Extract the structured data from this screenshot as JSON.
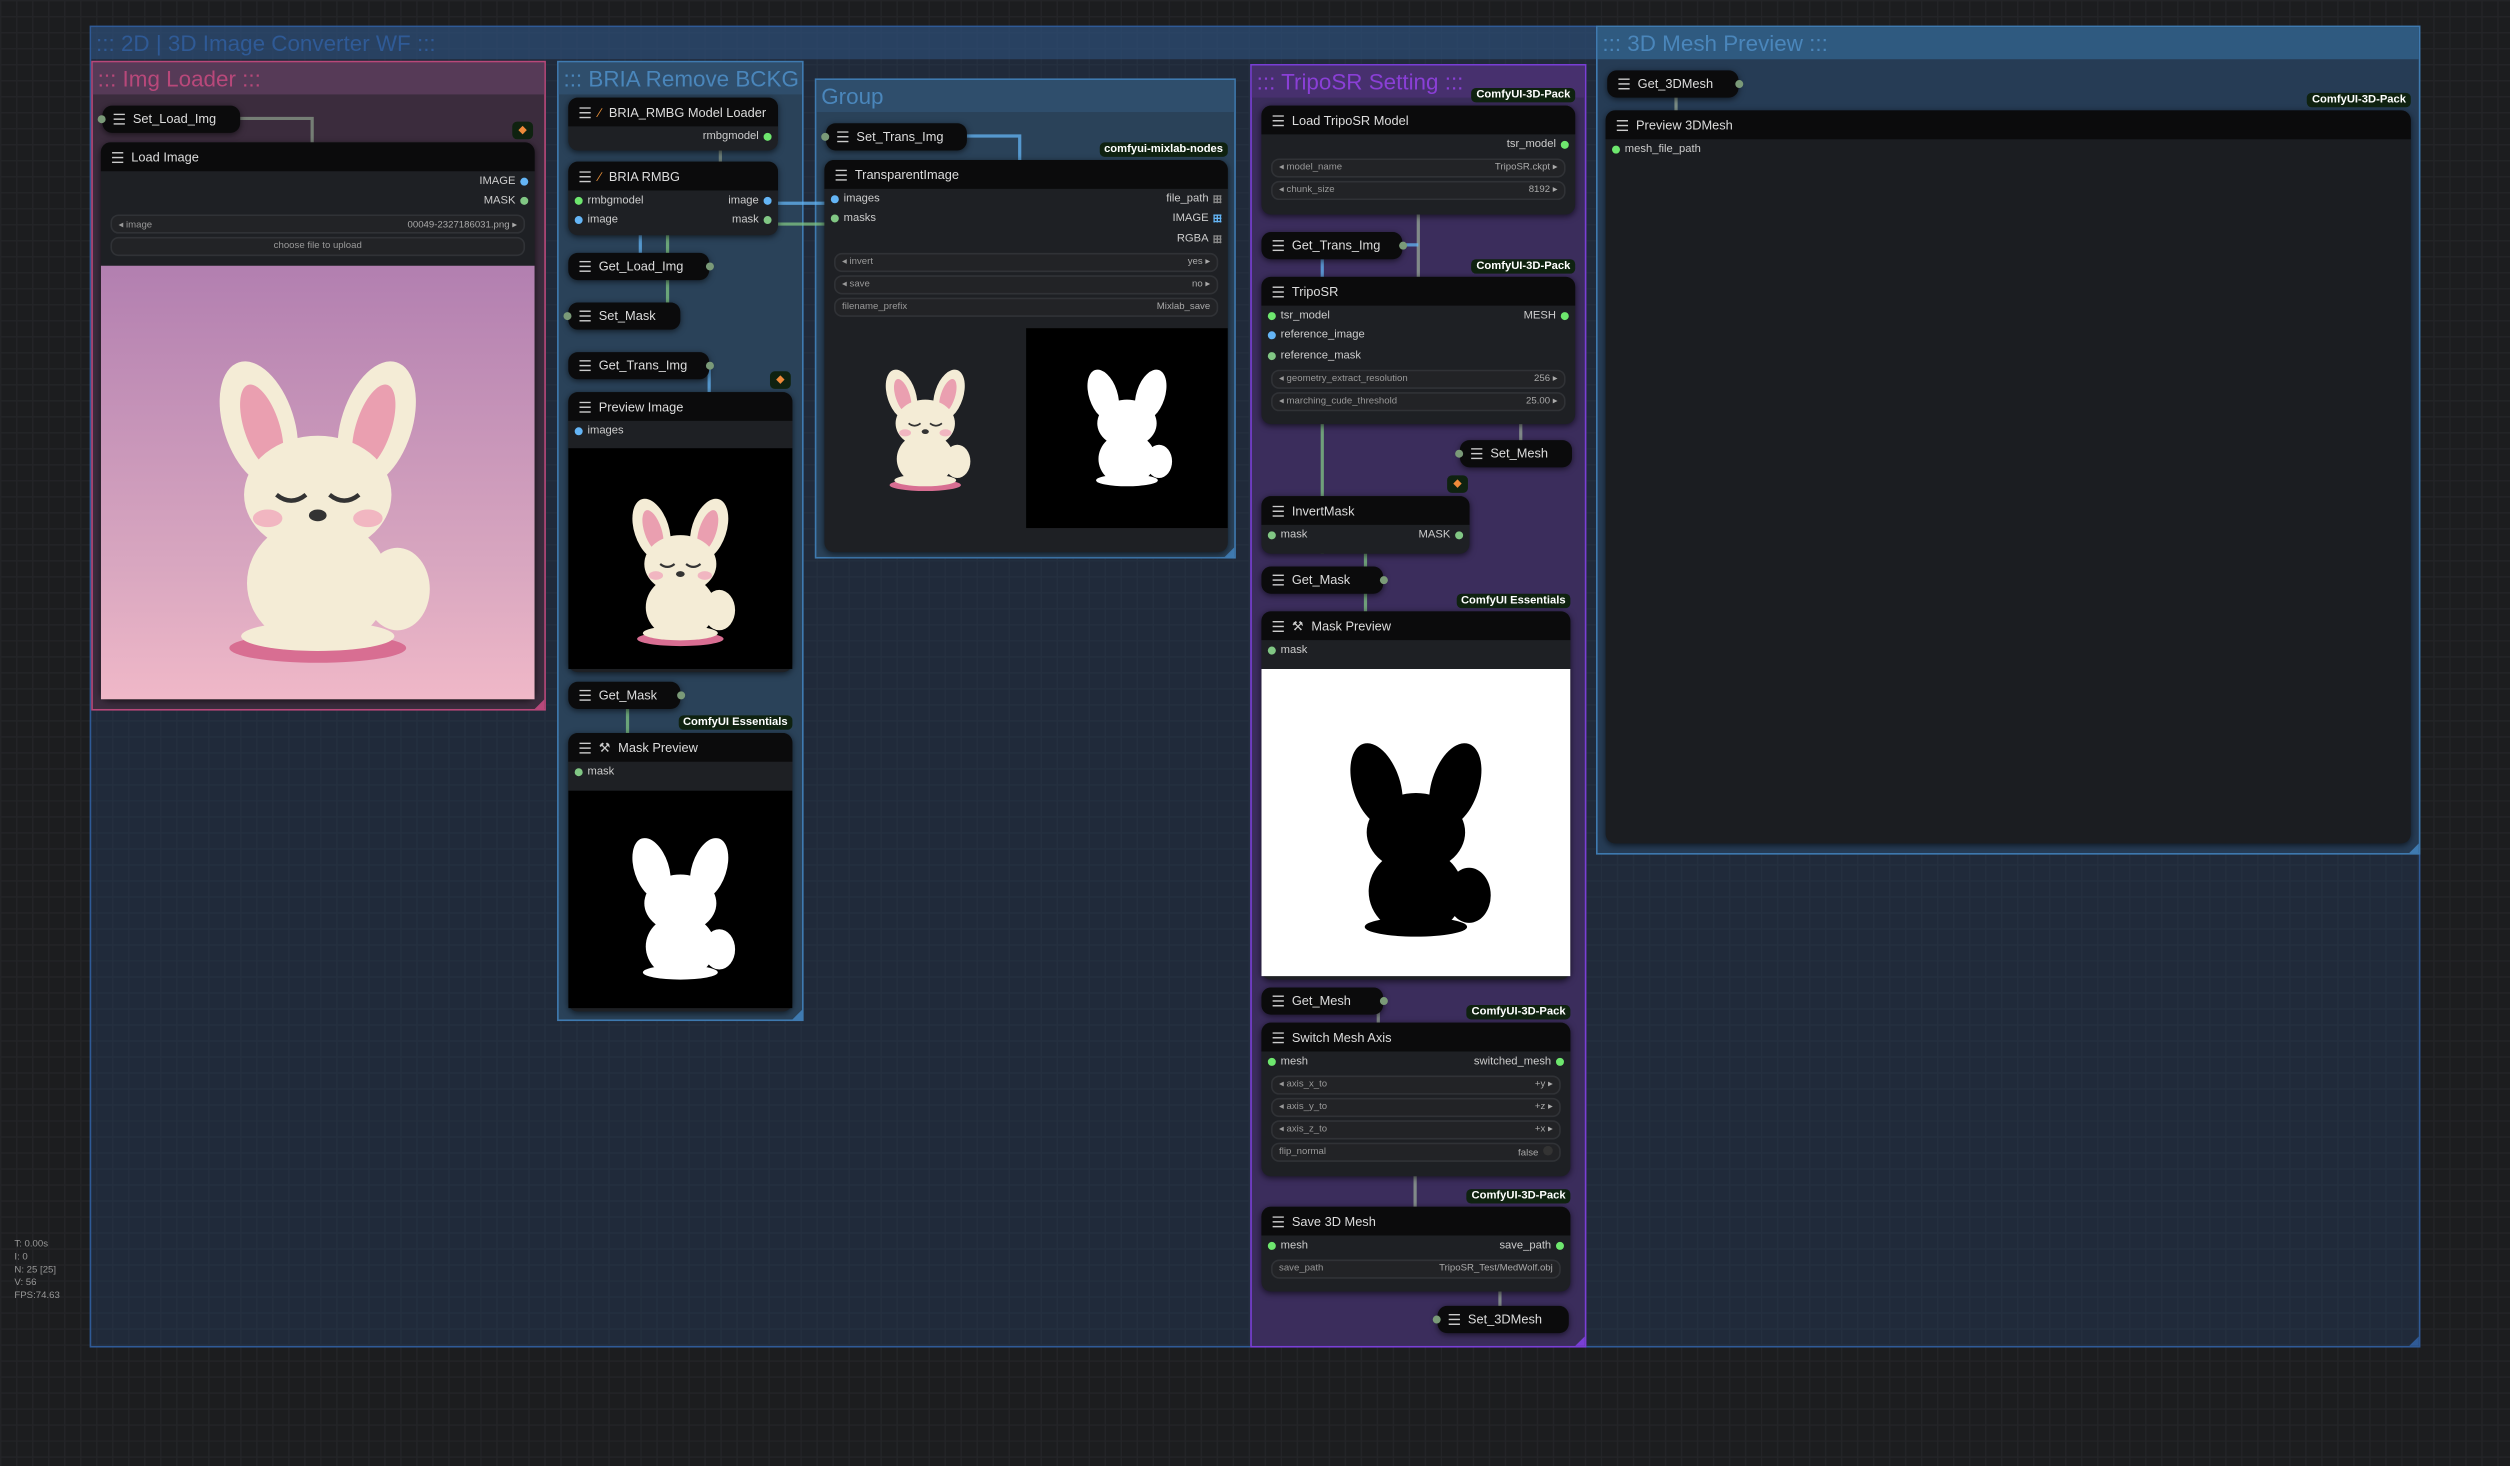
{
  "colors": {
    "image": "#64b5f6",
    "mask": "#81c784",
    "model": "#6ee76e",
    "mesh": "#6ee76e",
    "string": "#6ee76e",
    "badge_bg": "#0f2210"
  },
  "groups": [
    {
      "title": "::: 2D | 3D Image Converter WF :::",
      "color": "#2f5a96"
    },
    {
      "title": "::: Img Loader :::",
      "color": "#b8487a"
    },
    {
      "title": "::: BRIA Remove BCKG :::",
      "color": "#4a86bb"
    },
    {
      "title": "Group",
      "color": "#4a86bb"
    },
    {
      "title": "::: TripoSR Setting :::",
      "color": "#8a3fd6"
    },
    {
      "title": "::: 3D Mesh Preview :::",
      "color": "#4a86bb"
    }
  ],
  "nodes": [
    {
      "kind": "set",
      "title": "Set_Load_Img"
    },
    {
      "title": "Load Image",
      "badge_icon": "fox-icon",
      "outputs": [
        {
          "label": "IMAGE",
          "type": "image"
        },
        {
          "label": "MASK",
          "type": "mask"
        }
      ],
      "widgets": [
        {
          "kind": "combo",
          "name": "image",
          "value": "00049-2327186031.png"
        },
        {
          "kind": "button",
          "name": "choose file to upload"
        }
      ]
    },
    {
      "title": "BRIA_RMBG Model Loader",
      "icon": "brush-icon",
      "outputs": [
        {
          "label": "rmbgmodel",
          "type": "model"
        }
      ]
    },
    {
      "title": "BRIA RMBG",
      "icon": "brush-icon",
      "inputs": [
        {
          "label": "rmbgmodel",
          "type": "model"
        },
        {
          "label": "image",
          "type": "image"
        }
      ],
      "outputs": [
        {
          "label": "image",
          "type": "image"
        },
        {
          "label": "mask",
          "type": "mask"
        }
      ]
    },
    {
      "kind": "get",
      "title": "Get_Load_Img"
    },
    {
      "kind": "set",
      "title": "Set_Mask"
    },
    {
      "kind": "get",
      "title": "Get_Trans_Img"
    },
    {
      "title": "Preview Image",
      "badge_icon": "fox-icon",
      "inputs": [
        {
          "label": "images",
          "type": "image"
        }
      ]
    },
    {
      "kind": "get",
      "title": "Get_Mask"
    },
    {
      "title": "Mask Preview",
      "icon": "wrench-icon",
      "badge": "ComfyUI Essentials",
      "inputs": [
        {
          "label": "mask",
          "type": "mask"
        }
      ]
    },
    {
      "kind": "set",
      "title": "Set_Trans_Img"
    },
    {
      "title": "TransparentImage",
      "badge": "comfyui-mixlab-nodes",
      "inputs": [
        {
          "label": "images",
          "type": "image"
        },
        {
          "label": "masks",
          "type": "mask"
        }
      ],
      "outputs": [
        {
          "label": "file_path",
          "type": "list"
        },
        {
          "label": "IMAGE",
          "type": "imagelist"
        },
        {
          "label": "RGBA",
          "type": "list"
        }
      ],
      "widgets": [
        {
          "kind": "combo",
          "name": "invert",
          "value": "yes"
        },
        {
          "kind": "combo",
          "name": "save",
          "value": "no"
        },
        {
          "kind": "text",
          "name": "filename_prefix",
          "value": "Mixlab_save"
        }
      ]
    },
    {
      "title": "Load TripoSR Model",
      "badge": "ComfyUI-3D-Pack",
      "outputs": [
        {
          "label": "tsr_model",
          "type": "model"
        }
      ],
      "widgets": [
        {
          "kind": "combo",
          "name": "model_name",
          "value": "TripoSR.ckpt"
        },
        {
          "kind": "combo",
          "name": "chunk_size",
          "value": "8192"
        }
      ]
    },
    {
      "kind": "get",
      "title": "Get_Trans_Img"
    },
    {
      "title": "TripoSR",
      "badge": "ComfyUI-3D-Pack",
      "inputs": [
        {
          "label": "tsr_model",
          "type": "model"
        },
        {
          "label": "reference_image",
          "type": "image"
        },
        {
          "label": "reference_mask",
          "type": "mask"
        }
      ],
      "outputs": [
        {
          "label": "MESH",
          "type": "mesh"
        }
      ],
      "widgets": [
        {
          "kind": "combo",
          "name": "geometry_extract_resolution",
          "value": "256"
        },
        {
          "kind": "combo",
          "name": "marching_cude_threshold",
          "value": "25.00"
        }
      ]
    },
    {
      "kind": "set",
      "title": "Set_Mesh"
    },
    {
      "title": "InvertMask",
      "badge_icon": "fox-icon",
      "inputs": [
        {
          "label": "mask",
          "type": "mask"
        }
      ],
      "outputs": [
        {
          "label": "MASK",
          "type": "mask"
        }
      ]
    },
    {
      "kind": "get",
      "title": "Get_Mask"
    },
    {
      "title": "Mask Preview",
      "icon": "wrench-icon",
      "badge": "ComfyUI Essentials",
      "inputs": [
        {
          "label": "mask",
          "type": "mask"
        }
      ]
    },
    {
      "kind": "get",
      "title": "Get_Mesh"
    },
    {
      "title": "Switch Mesh Axis",
      "badge": "ComfyUI-3D-Pack",
      "inputs": [
        {
          "label": "mesh",
          "type": "mesh"
        }
      ],
      "outputs": [
        {
          "label": "switched_mesh",
          "type": "mesh"
        }
      ],
      "widgets": [
        {
          "kind": "combo",
          "name": "axis_x_to",
          "value": "+y"
        },
        {
          "kind": "combo",
          "name": "axis_y_to",
          "value": "+z"
        },
        {
          "kind": "combo",
          "name": "axis_z_to",
          "value": "+x"
        },
        {
          "kind": "toggle",
          "name": "flip_normal",
          "value": "false"
        }
      ]
    },
    {
      "title": "Save 3D Mesh",
      "badge": "ComfyUI-3D-Pack",
      "inputs": [
        {
          "label": "mesh",
          "type": "mesh"
        }
      ],
      "outputs": [
        {
          "label": "save_path",
          "type": "string"
        }
      ],
      "widgets": [
        {
          "kind": "text",
          "name": "save_path",
          "value": "TripoSR_Test/MedWolf.obj"
        }
      ]
    },
    {
      "kind": "set",
      "title": "Set_3DMesh"
    },
    {
      "kind": "get",
      "title": "Get_3DMesh"
    },
    {
      "title": "Preview 3DMesh",
      "badge": "ComfyUI-3D-Pack",
      "inputs": [
        {
          "label": "mesh_file_path",
          "type": "mesh"
        }
      ]
    }
  ],
  "stats": [
    "T: 0.00s",
    "I: 0",
    "N: 25 [25]",
    "V: 56",
    "FPS:74.63"
  ]
}
